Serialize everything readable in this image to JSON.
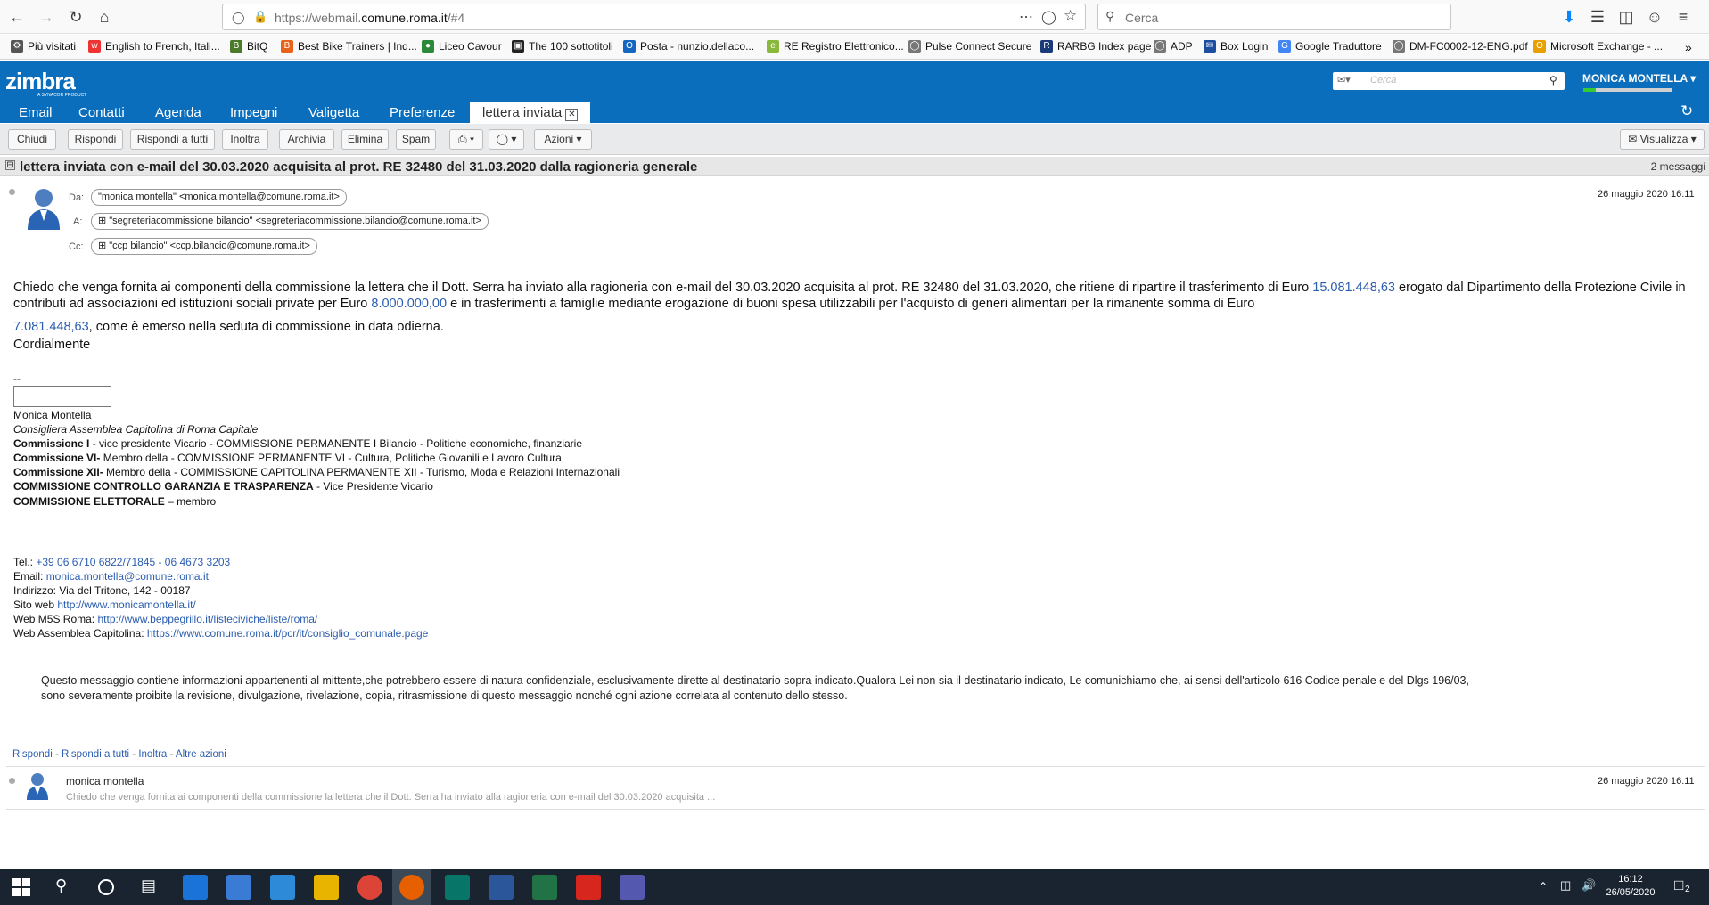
{
  "browser": {
    "url_prefix": "https://webmail.",
    "url_domain": "comune.roma.it",
    "url_suffix": "/#4",
    "search_placeholder": "Cerca",
    "bookmarks": [
      "Più visitati",
      "English to French, Itali...",
      "BitQ",
      "Best Bike Trainers | Ind...",
      "Liceo Cavour",
      "The 100 sottotitoli",
      "Posta - nunzio.dellaco...",
      "RE Registro Elettronico...",
      "Pulse Connect Secure",
      "RARBG Index page",
      "ADP",
      "Box Login",
      "Google Traduttore",
      "DM-FC0002-12-ENG.pdf",
      "Microsoft Exchange - ..."
    ]
  },
  "zimbra": {
    "logo": "zimbra",
    "logo_sub": "A SYNACOR PRODUCT",
    "search_placeholder": "Cerca",
    "user": "MONICA MONTELLA",
    "quota_fraction": 0.14,
    "tabs": [
      "Email",
      "Contatti",
      "Agenda",
      "Impegni",
      "Valigetta",
      "Preferenze",
      "lettera inviata"
    ]
  },
  "toolbar": {
    "close": "Chiudi",
    "reply": "Rispondi",
    "reply_all": "Rispondi a tutti",
    "forward": "Inoltra",
    "archive": "Archivia",
    "delete": "Elimina",
    "spam": "Spam",
    "actions": "Azioni",
    "view": "Visualizza"
  },
  "conversation": {
    "subject": "lettera inviata con e-mail del 30.03.2020 acquisita al prot. RE 32480 del 31.03.2020 dalla ragioneria generale",
    "count": "2 messaggi"
  },
  "message": {
    "from_label": "Da:",
    "to_label": "A:",
    "cc_label": "Cc:",
    "from": "\"monica montella\" <monica.montella@comune.roma.it>",
    "to": "\"segreteriacommissione bilancio\" <segreteriacommissione.bilancio@comune.roma.it>",
    "cc": "\"ccp bilancio\" <ccp.bilancio@comune.roma.it>",
    "date": "26 maggio 2020 16:11",
    "body_1": "Chiedo che venga fornita ai componenti della commissione la lettera che il Dott. Serra ha inviato alla ragioneria con e-mail del 30.03.2020 acquisita al prot. RE 32480 del 31.03.2020, che ritiene di ripartire il trasferimento di Euro ",
    "amount_1": "15.081.448,63",
    "body_2": " erogato dal Dipartimento della Protezione Civile in contributi ad associazioni ed istituzioni sociali private per Euro ",
    "amount_2": "8.000.000,00",
    "body_3": " e in trasferimenti a famiglie mediante erogazione di buoni spesa utilizzabili per l'acquisto di generi alimentari per la rimanente somma di Euro",
    "amount_3": "7.081.448,63",
    "body_4": ", come è emerso nella seduta di commissione in data odierna.",
    "closing": "Cordialmente",
    "sig_sep": "--",
    "sig_name": "Monica Montella",
    "sig_role": "Consigliera Assemblea Capitolina di Roma Capitale",
    "c1_b": "Commissione I",
    "c1": " - vice presidente Vicario - COMMISSIONE PERMANENTE I Bilancio - Politiche economiche, finanziarie",
    "c6_b": "Commissione VI-",
    "c6": " Membro della - COMMISSIONE PERMANENTE VI - Cultura, Politiche Giovanili e Lavoro Cultura",
    "c12_b": "Commissione XII-",
    "c12": " Membro della - COMMISSIONE CAPITOLINA PERMANENTE XII - Turismo, Moda e Relazioni Internazionali",
    "cg_b": "COMMISSIONE CONTROLLO GARANZIA E TRASPARENZA",
    "cg": " - Vice Presidente Vicario",
    "ce_b": "COMMISSIONE ELETTORALE",
    "ce": " – membro",
    "tel_label": "Tel.: ",
    "tel": "+39 06 6710 6822/71845 - 06 4673 3203",
    "email_label": "Email: ",
    "email": "monica.montella@comune.roma.it",
    "addr": "Indirizzo: Via del Tritone, 142 - 00187",
    "site_label": "Sito web ",
    "site": "http://www.monicamontella.it/",
    "m5s_label": "Web M5S Roma: ",
    "m5s": "http://www.beppegrillo.it/listeciviche/liste/roma/",
    "ac_label": "Web Assemblea Capitolina: ",
    "ac": "https://www.comune.roma.it/pcr/it/consiglio_comunale.page",
    "disclaimer_1": " Questo messaggio contiene informazioni appartenenti al mittente,che potrebbero essere di natura confidenziale, esclusivamente dirette al destinatario sopra indicato.Qualora Lei non sia il destinatario indicato, Le comunichiamo che, ai sensi dell'articolo 616 Codice penale e del Dlgs 196/03,",
    "disclaimer_2": "sono severamente proibite la revisione, divulgazione, rivelazione, copia, ritrasmissione di questo messaggio nonché ogni azione correlata al contenuto dello stesso.",
    "actions": [
      "Rispondi",
      "Rispondi a tutti",
      "Inoltra",
      "Altre azioni"
    ]
  },
  "message2": {
    "sender": "monica montella",
    "preview": "Chiedo che venga fornita ai componenti della commissione la lettera che il Dott. Serra ha inviato alla ragioneria con e-mail del 30.03.2020 acquisita ...",
    "date": "26 maggio 2020 16:11"
  },
  "taskbar": {
    "time": "16:12",
    "date": "26/05/2020",
    "notif": "2"
  }
}
